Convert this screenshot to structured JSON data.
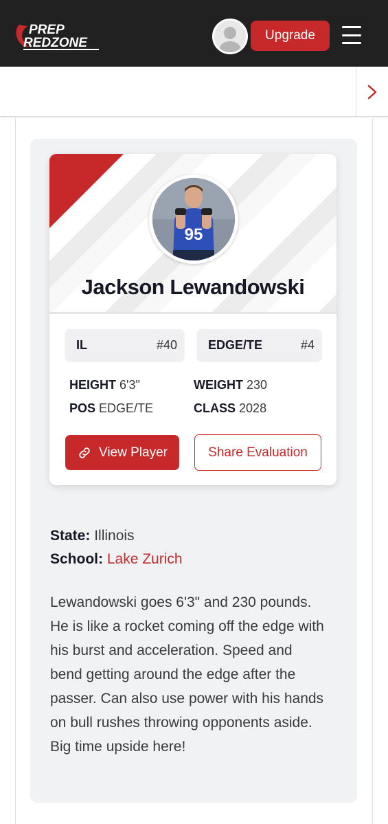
{
  "header": {
    "logo_text_top": "PREP",
    "logo_text_bottom": "REDZONE",
    "upgrade_label": "Upgrade",
    "brand_color": "#c7292b",
    "bar_color": "#212121"
  },
  "subnav": {
    "next_icon": "chevron-right-icon"
  },
  "player": {
    "name": "Jackson Lewandowski",
    "jersey_number": "95",
    "positions": [
      {
        "position": "IL",
        "rank": "#40"
      },
      {
        "position": "EDGE/TE",
        "rank": "#4"
      }
    ],
    "stats": {
      "height_label": "HEIGHT",
      "height_value": "6'3\"",
      "weight_label": "WEIGHT",
      "weight_value": "230",
      "pos_label": "POS",
      "pos_value": "EDGE/TE",
      "class_label": "CLASS",
      "class_value": "2028"
    },
    "actions": {
      "view_label": "View Player",
      "share_label": "Share Evaluation"
    }
  },
  "details": {
    "state_label": "State:",
    "state_value": "Illinois",
    "school_label": "School:",
    "school_value": "Lake Zurich",
    "evaluation": "Lewandowski goes 6'3\" and 230 pounds.  He is like a rocket coming off the edge with his burst and acceleration.  Speed and bend getting around the edge after the passer.  Can also use power with his hands on bull rushes throwing opponents aside.  Big time upside here!"
  }
}
